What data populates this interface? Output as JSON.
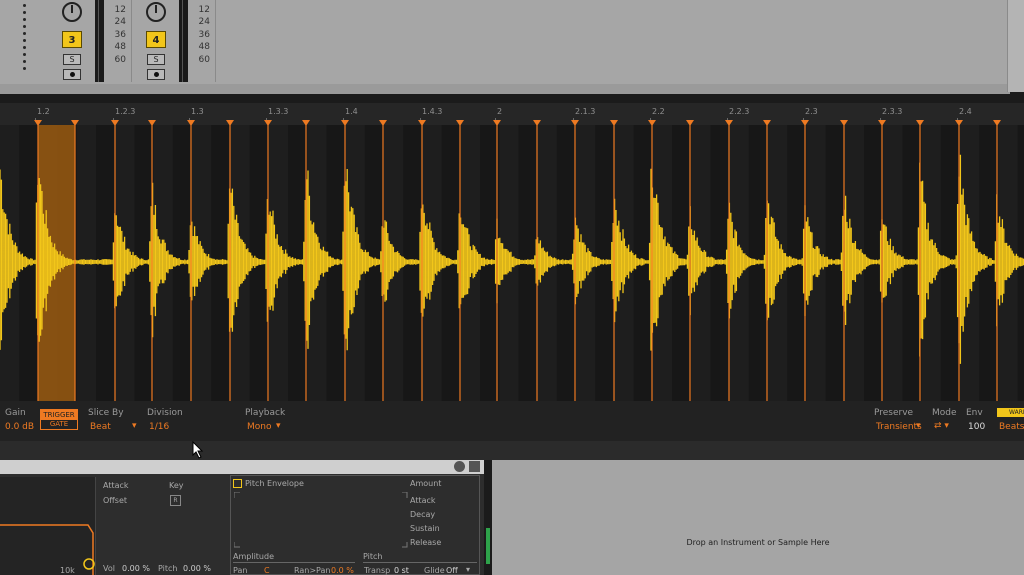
{
  "mixer": {
    "tracks": [
      {
        "number": "3",
        "solo": "S"
      },
      {
        "number": "4",
        "solo": "S"
      }
    ],
    "meter_scale": [
      "12",
      "24",
      "36",
      "48",
      "60"
    ]
  },
  "ruler": {
    "markers": [
      "1.2",
      "1.2.3",
      "1.3",
      "1.3.3",
      "1.4",
      "1.4.3",
      "2",
      "2.1.3",
      "2.2",
      "2.2.3",
      "2.3",
      "2.3.3",
      "2.4"
    ]
  },
  "colors": {
    "waveform": "#f2c61a",
    "slice_marker": "#ee7a22",
    "selected_slice": "#9a5a10"
  },
  "params": {
    "gain_label": "Gain",
    "gain_value": "0.0 dB",
    "trigger_label": "TRIGGER",
    "gate_label": "GATE",
    "slice_by_label": "Slice By",
    "slice_by_value": "Beat",
    "division_label": "Division",
    "division_value": "1/16",
    "playback_label": "Playback",
    "playback_value": "Mono",
    "preserve_label": "Preserve",
    "preserve_value": "Transients",
    "mode_label": "Mode",
    "env_label": "Env",
    "env_value": "100",
    "warp_label": "WARP",
    "beats_value": "Beats"
  },
  "device": {
    "filter_freq": "10k",
    "attack_label": "Attack",
    "key_label": "Key",
    "key_value": "R",
    "offset_label": "Offset",
    "vol_label": "Vol",
    "vol_value": "0.00 %",
    "pitch_label": "Pitch",
    "pitch_value": "0.00 %",
    "pitch_env_label": "Pitch Envelope",
    "amount_label": "Amount",
    "env_attack": "Attack",
    "env_decay": "Decay",
    "env_sustain": "Sustain",
    "env_release": "Release",
    "amplitude_label": "Amplitude",
    "pan_label": "Pan",
    "pan_value": "C",
    "ranpan_label": "Ran>Pan",
    "ranpan_value": "0.0 %",
    "pitch2_label": "Pitch",
    "transp_label": "Transp",
    "transp_value": "0 st",
    "glide_label": "Glide",
    "glide_value": "Off"
  },
  "drop_text": "Drop an Instrument or Sample Here"
}
